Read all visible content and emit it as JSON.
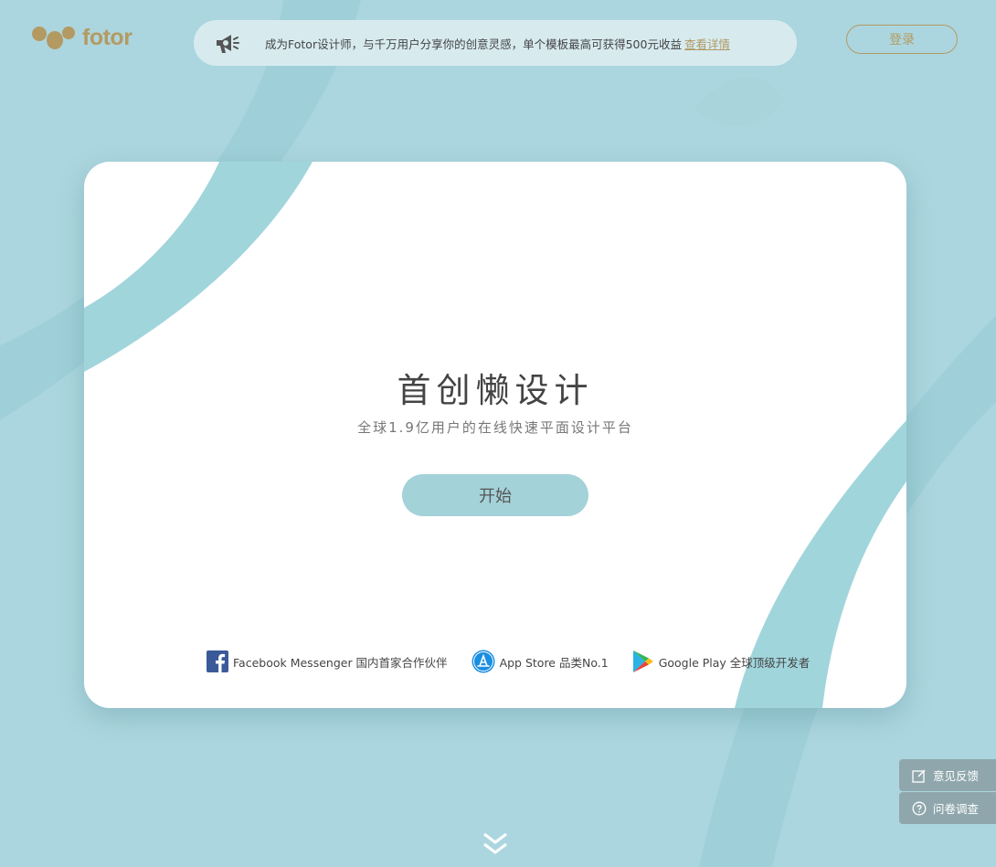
{
  "header": {
    "logo_text": "fotor",
    "banner": {
      "icon": "megaphone-icon",
      "text": "成为Fotor设计师，与千万用户分享你的创意灵感，单个模板最高可获得500元收益",
      "link_label": "查看详情"
    },
    "login_label": "登录"
  },
  "hero": {
    "title": "首创懒设计",
    "subtitle": "全球1.9亿用户的在线快速平面设计平台",
    "start_label": "开始"
  },
  "partners": [
    {
      "icon": "facebook-icon",
      "label": "Facebook Messenger 国内首家合作伙伴"
    },
    {
      "icon": "app-store-icon",
      "label": "App Store 品类No.1"
    },
    {
      "icon": "google-play-icon",
      "label": "Google Play 全球顶级开发者"
    }
  ],
  "side_panel": {
    "feedback_label": "意见反馈",
    "survey_label": "问卷调查"
  },
  "colors": {
    "background": "#acd6df",
    "brand_gold": "#b39a63",
    "start_button": "#a4d2d9",
    "side_panel": "#8fa7ac"
  }
}
